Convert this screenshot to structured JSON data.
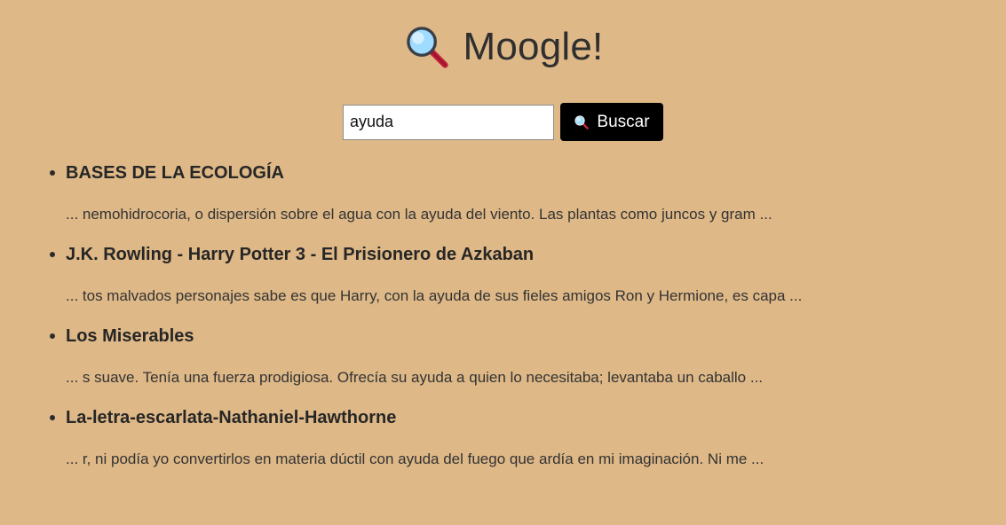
{
  "app": {
    "title": "Moogle!",
    "title_icon": "magnifying-glass-icon"
  },
  "search": {
    "query": "ayuda",
    "button_label": "Buscar",
    "button_icon": "magnifying-glass-icon"
  },
  "results": [
    {
      "title": "BASES DE LA ECOLOGÍA",
      "snippet": "... nemohidrocoria, o dispersión sobre el agua con la ayuda del viento. Las plantas como juncos y gram ..."
    },
    {
      "title": "J.K. Rowling - Harry Potter 3 - El Prisionero de Azkaban",
      "snippet": "... tos malvados personajes sabe es que Harry, con la ayuda de sus fieles amigos Ron y Hermione, es capa ..."
    },
    {
      "title": "Los Miserables",
      "snippet": "... s suave. Tenía una fuerza prodigiosa. Ofrecía su ayuda a quien lo necesitaba; levantaba un caballo ..."
    },
    {
      "title": "La-letra-escarlata-Nathaniel-Hawthorne",
      "snippet": "... r, ni podía yo convertirlos en materia dúctil con ayuda del fuego que ardía en mi imaginación. Ni me ..."
    }
  ],
  "colors": {
    "background": "#deb887",
    "button_background": "#000000",
    "button_text": "#ffffff",
    "text": "#2b2b2b"
  }
}
